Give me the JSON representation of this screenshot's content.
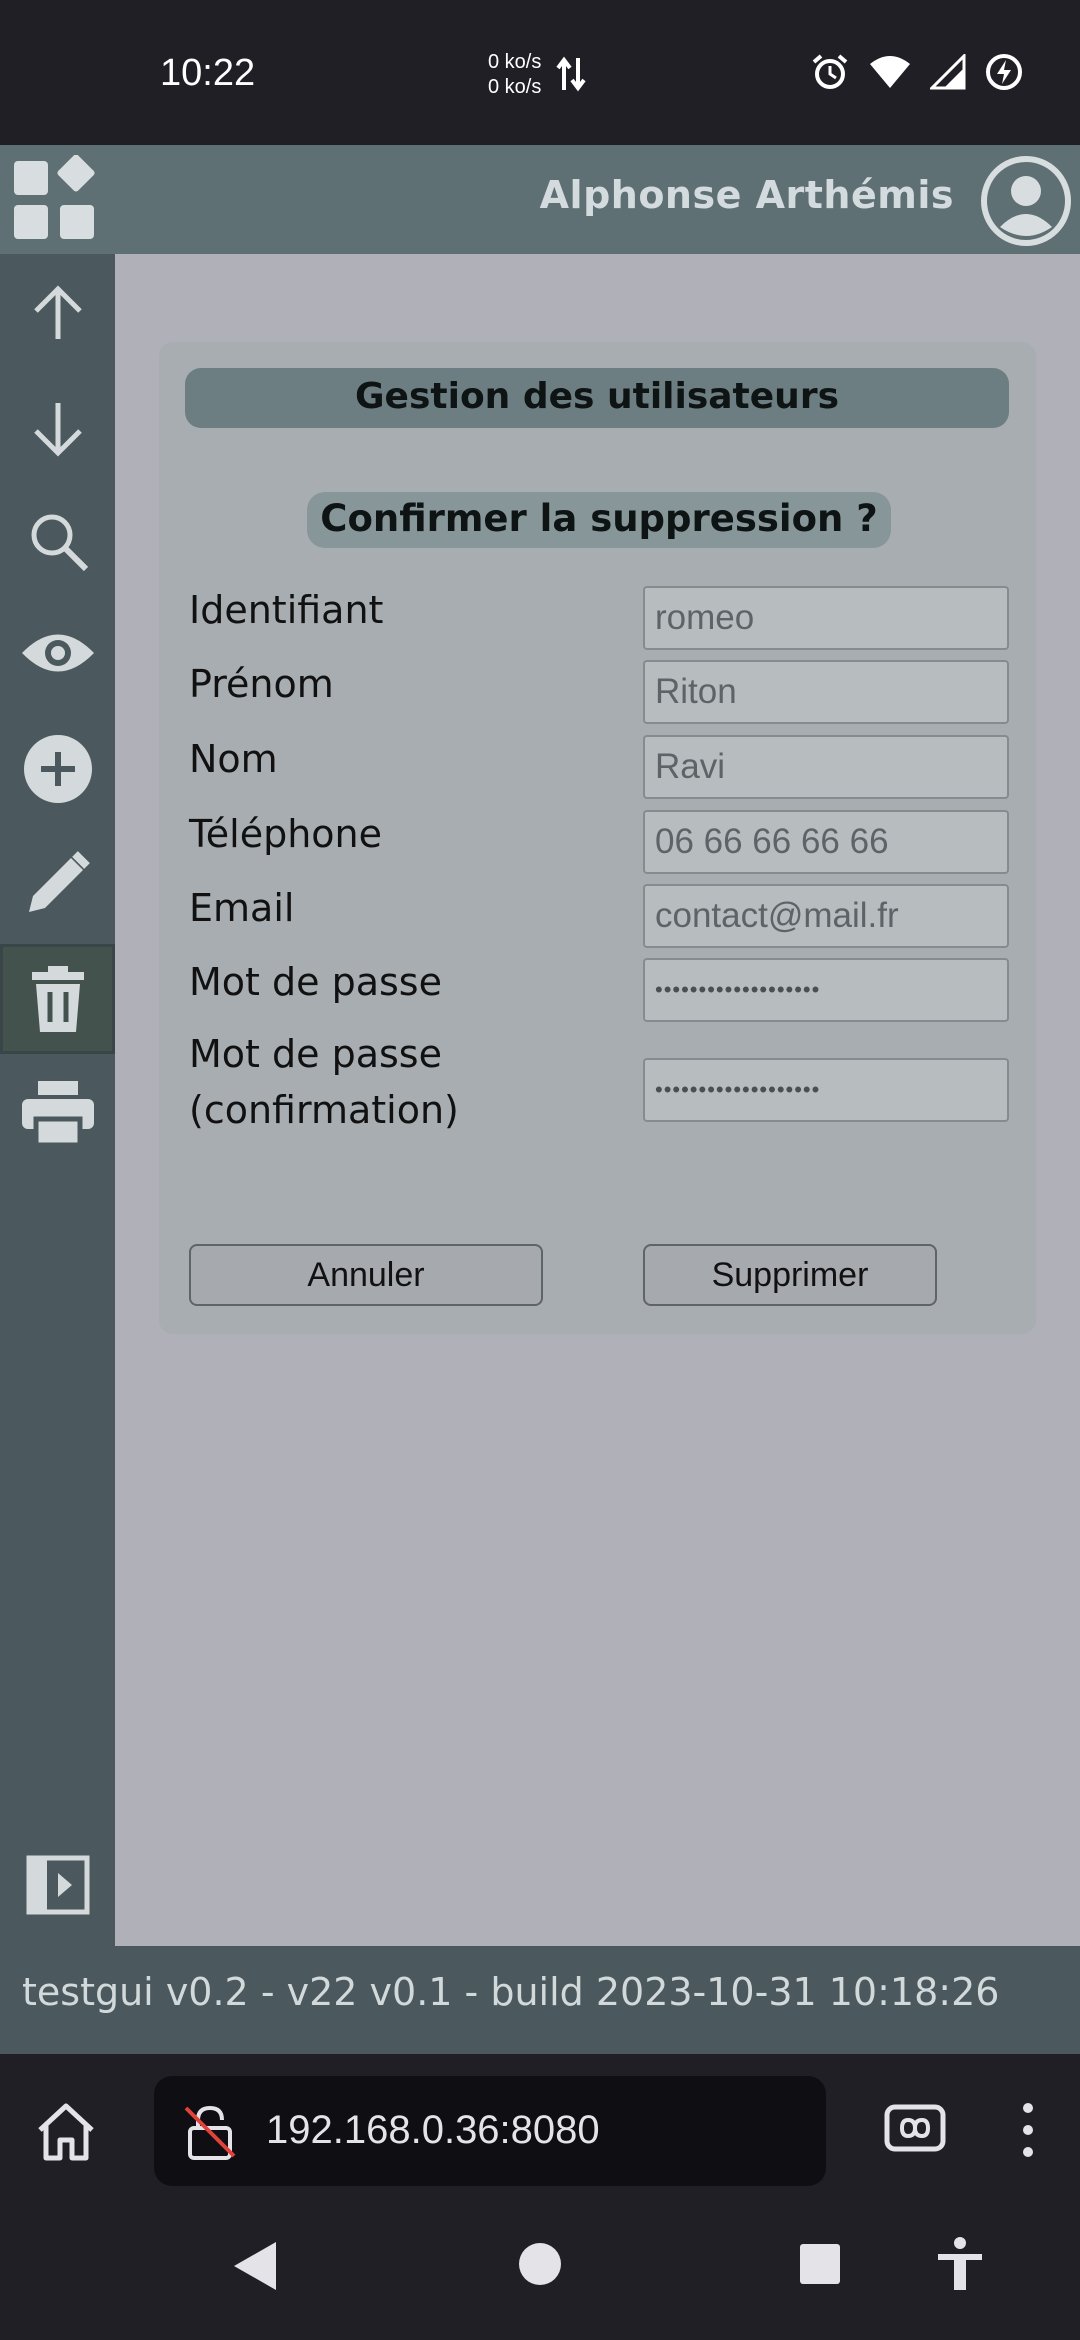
{
  "status_bar": {
    "time": "10:22",
    "net_up": "0 ko/s",
    "net_down": "0 ko/s",
    "icons": [
      "arrows-updown-icon",
      "alarm-icon",
      "wifi-icon",
      "signal-icon",
      "battery-saver-icon"
    ]
  },
  "header": {
    "username": "Alphonse Arthémis",
    "icons": [
      "apps-icon",
      "avatar-icon"
    ]
  },
  "sidebar": {
    "items": [
      {
        "icon": "arrow-up-icon",
        "active": false
      },
      {
        "icon": "arrow-down-icon",
        "active": false
      },
      {
        "icon": "search-icon",
        "active": false
      },
      {
        "icon": "eye-icon",
        "active": false
      },
      {
        "icon": "plus-circle-icon",
        "active": false
      },
      {
        "icon": "pencil-icon",
        "active": false
      },
      {
        "icon": "trash-icon",
        "active": true
      },
      {
        "icon": "printer-icon",
        "active": false
      },
      {
        "icon": "panel-toggle-icon",
        "active": false
      }
    ]
  },
  "card": {
    "title": "Gestion des utilisateurs",
    "subtitle": "Confirmer la suppression ?",
    "fields": [
      {
        "label": "Identifiant",
        "value": "romeo"
      },
      {
        "label": "Prénom",
        "value": "Riton"
      },
      {
        "label": "Nom",
        "value": "Ravi"
      },
      {
        "label": "Téléphone",
        "value": "06 66 66 66 66"
      },
      {
        "label": "Email",
        "value": "contact@mail.fr"
      },
      {
        "label": "Mot de passe",
        "value": "•••••••••••••••••••"
      },
      {
        "label": "Mot de passe (confirmation)",
        "value": "•••••••••••••••••••"
      }
    ],
    "cancel_label": "Annuler",
    "delete_label": "Supprimer"
  },
  "footer": {
    "text": "testgui v0.2 - v22 v0.1 - build 2023-10-31 10:18:26"
  },
  "browser": {
    "url": "192.168.0.36:8080",
    "icons": [
      "home-icon",
      "insecure-lock-icon",
      "tabs-icon",
      "more-vertical-icon"
    ]
  },
  "navbar": {
    "icons": [
      "back-icon",
      "home-circle-icon",
      "recents-icon",
      "accessibility-icon"
    ]
  },
  "colors": {
    "header_bg": "#5f7074",
    "sidebar_bg": "#4b585d",
    "main_bg": "#b0b0b9",
    "card_bg": "#a7adb1"
  }
}
